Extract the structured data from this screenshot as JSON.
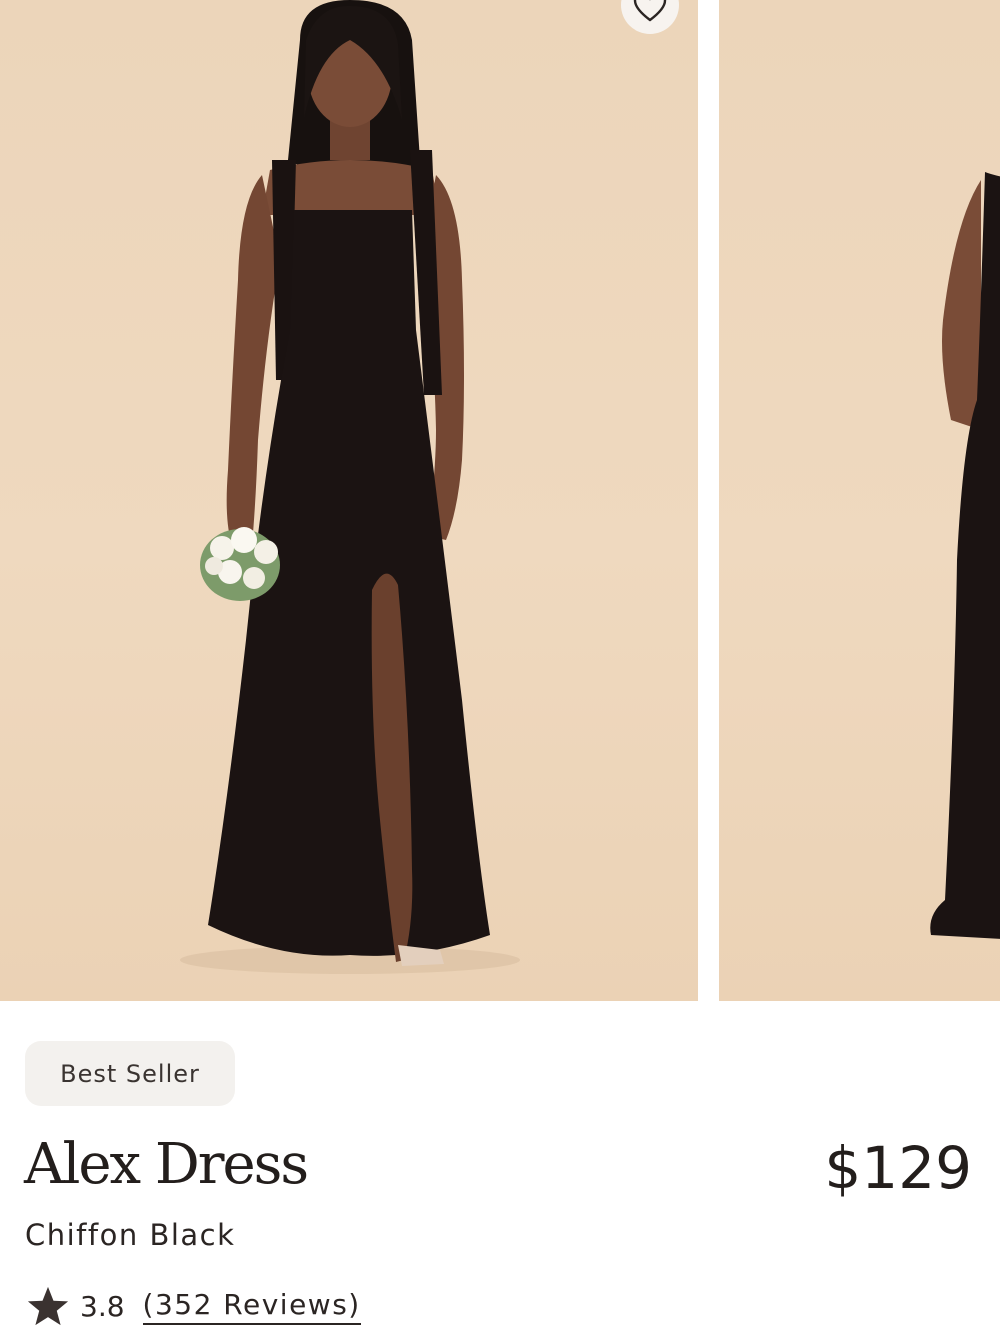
{
  "product": {
    "badge": "Best Seller",
    "name": "Alex Dress",
    "price": "$129",
    "variant": "Chiffon Black",
    "rating": "3.8",
    "reviews": "(352 Reviews)",
    "rating_out_of": 5
  },
  "carousel": {
    "slides": [
      "front-view",
      "back-view"
    ],
    "background_color": "#ecd5ba",
    "dress_color": "#1b1312"
  },
  "icons": {
    "favorite": "heart-icon",
    "rating": "star-icon"
  }
}
